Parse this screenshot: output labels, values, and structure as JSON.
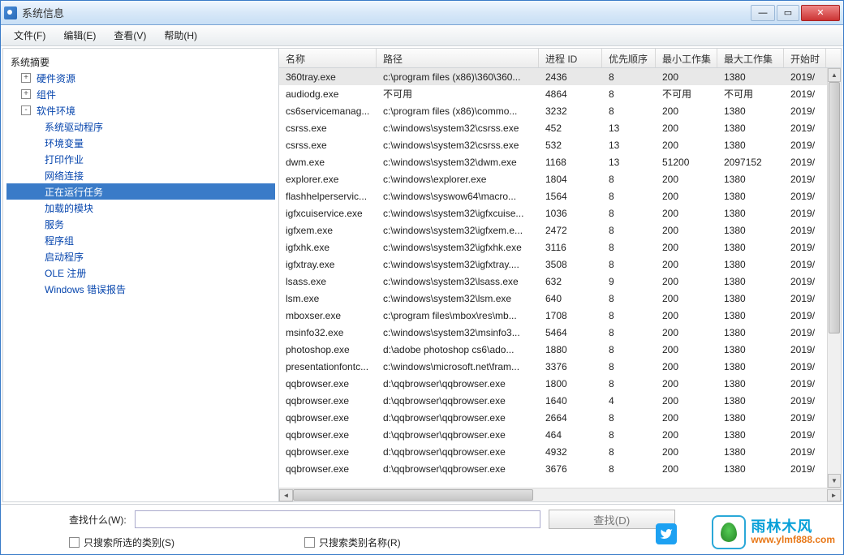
{
  "window": {
    "title": "系统信息"
  },
  "menu": {
    "file": "文件(F)",
    "edit": "编辑(E)",
    "view": "查看(V)",
    "help": "帮助(H)"
  },
  "tree": {
    "root": "系统摘要",
    "nodes": [
      {
        "label": "硬件资源",
        "expand": "+"
      },
      {
        "label": "组件",
        "expand": "+"
      },
      {
        "label": "软件环境",
        "expand": "-",
        "children": [
          {
            "label": "系统驱动程序"
          },
          {
            "label": "环境变量"
          },
          {
            "label": "打印作业"
          },
          {
            "label": "网络连接"
          },
          {
            "label": "正在运行任务",
            "selected": true
          },
          {
            "label": "加载的模块"
          },
          {
            "label": "服务"
          },
          {
            "label": "程序组"
          },
          {
            "label": "启动程序"
          },
          {
            "label": "OLE 注册"
          },
          {
            "label": "Windows 错误报告"
          }
        ]
      }
    ]
  },
  "columns": [
    "名称",
    "路径",
    "进程 ID",
    "优先顺序",
    "最小工作集",
    "最大工作集",
    "开始时"
  ],
  "rows": [
    [
      "360tray.exe",
      "c:\\program files (x86)\\360\\360...",
      "2436",
      "8",
      "200",
      "1380",
      "2019/"
    ],
    [
      "audiodg.exe",
      "不可用",
      "4864",
      "8",
      "不可用",
      "不可用",
      "2019/"
    ],
    [
      "cs6servicemanag...",
      "c:\\program files (x86)\\commo...",
      "3232",
      "8",
      "200",
      "1380",
      "2019/"
    ],
    [
      "csrss.exe",
      "c:\\windows\\system32\\csrss.exe",
      "452",
      "13",
      "200",
      "1380",
      "2019/"
    ],
    [
      "csrss.exe",
      "c:\\windows\\system32\\csrss.exe",
      "532",
      "13",
      "200",
      "1380",
      "2019/"
    ],
    [
      "dwm.exe",
      "c:\\windows\\system32\\dwm.exe",
      "1168",
      "13",
      "51200",
      "2097152",
      "2019/"
    ],
    [
      "explorer.exe",
      "c:\\windows\\explorer.exe",
      "1804",
      "8",
      "200",
      "1380",
      "2019/"
    ],
    [
      "flashhelperservic...",
      "c:\\windows\\syswow64\\macro...",
      "1564",
      "8",
      "200",
      "1380",
      "2019/"
    ],
    [
      "igfxcuiservice.exe",
      "c:\\windows\\system32\\igfxcuise...",
      "1036",
      "8",
      "200",
      "1380",
      "2019/"
    ],
    [
      "igfxem.exe",
      "c:\\windows\\system32\\igfxem.e...",
      "2472",
      "8",
      "200",
      "1380",
      "2019/"
    ],
    [
      "igfxhk.exe",
      "c:\\windows\\system32\\igfxhk.exe",
      "3116",
      "8",
      "200",
      "1380",
      "2019/"
    ],
    [
      "igfxtray.exe",
      "c:\\windows\\system32\\igfxtray....",
      "3508",
      "8",
      "200",
      "1380",
      "2019/"
    ],
    [
      "lsass.exe",
      "c:\\windows\\system32\\lsass.exe",
      "632",
      "9",
      "200",
      "1380",
      "2019/"
    ],
    [
      "lsm.exe",
      "c:\\windows\\system32\\lsm.exe",
      "640",
      "8",
      "200",
      "1380",
      "2019/"
    ],
    [
      "mboxser.exe",
      "c:\\program files\\mbox\\res\\mb...",
      "1708",
      "8",
      "200",
      "1380",
      "2019/"
    ],
    [
      "msinfo32.exe",
      "c:\\windows\\system32\\msinfo3...",
      "5464",
      "8",
      "200",
      "1380",
      "2019/"
    ],
    [
      "photoshop.exe",
      "d:\\adobe photoshop cs6\\ado...",
      "1880",
      "8",
      "200",
      "1380",
      "2019/"
    ],
    [
      "presentationfontc...",
      "c:\\windows\\microsoft.net\\fram...",
      "3376",
      "8",
      "200",
      "1380",
      "2019/"
    ],
    [
      "qqbrowser.exe",
      "d:\\qqbrowser\\qqbrowser.exe",
      "1800",
      "8",
      "200",
      "1380",
      "2019/"
    ],
    [
      "qqbrowser.exe",
      "d:\\qqbrowser\\qqbrowser.exe",
      "1640",
      "4",
      "200",
      "1380",
      "2019/"
    ],
    [
      "qqbrowser.exe",
      "d:\\qqbrowser\\qqbrowser.exe",
      "2664",
      "8",
      "200",
      "1380",
      "2019/"
    ],
    [
      "qqbrowser.exe",
      "d:\\qqbrowser\\qqbrowser.exe",
      "464",
      "8",
      "200",
      "1380",
      "2019/"
    ],
    [
      "qqbrowser.exe",
      "d:\\qqbrowser\\qqbrowser.exe",
      "4932",
      "8",
      "200",
      "1380",
      "2019/"
    ],
    [
      "qqbrowser.exe",
      "d:\\qqbrowser\\qqbrowser.exe",
      "3676",
      "8",
      "200",
      "1380",
      "2019/"
    ]
  ],
  "search": {
    "label": "查找什么(W):",
    "button": "查找(D)",
    "chk1": "只搜索所选的类别(S)",
    "chk2": "只搜索类别名称(R)"
  },
  "logo": {
    "cn": "雨林木风",
    "url": "www.ylmf888.com"
  }
}
